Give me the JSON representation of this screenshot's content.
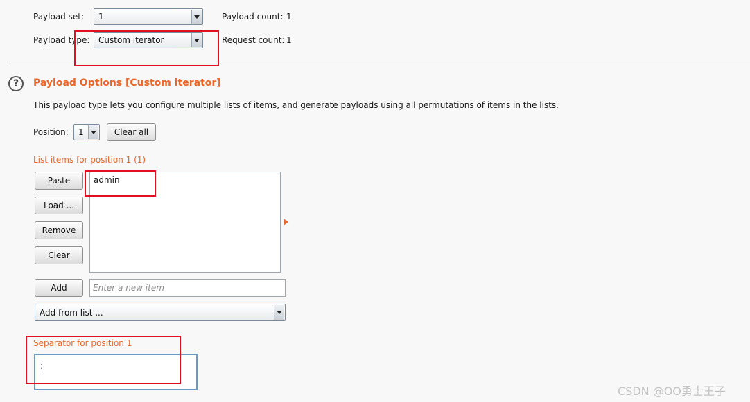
{
  "payload_set": {
    "label": "Payload set:",
    "value": "1",
    "count_label": "Payload count:",
    "count_value": "1"
  },
  "payload_type": {
    "label": "Payload type:",
    "value": "Custom iterator",
    "request_label": "Request count:",
    "request_value": "1"
  },
  "options": {
    "title": "Payload Options [Custom iterator]",
    "description": "This payload type lets you configure multiple lists of items, and generate payloads using all permutations of items in the lists.",
    "position_label": "Position:",
    "position_value": "1",
    "clear_all": "Clear all",
    "list_heading": "List items for position 1 (1)",
    "buttons": {
      "paste": "Paste",
      "load": "Load ...",
      "remove": "Remove",
      "clear": "Clear",
      "add": "Add"
    },
    "items": [
      "admin"
    ],
    "new_item_placeholder": "Enter a new item",
    "add_from_list": "Add from list ...",
    "separator_label": "Separator for position 1",
    "separator_value": ":"
  },
  "watermark": "CSDN @OO勇士王子",
  "colors": {
    "accent": "#e8672b",
    "highlight": "#e10f1f",
    "field_focus": "#6a9ac4"
  }
}
